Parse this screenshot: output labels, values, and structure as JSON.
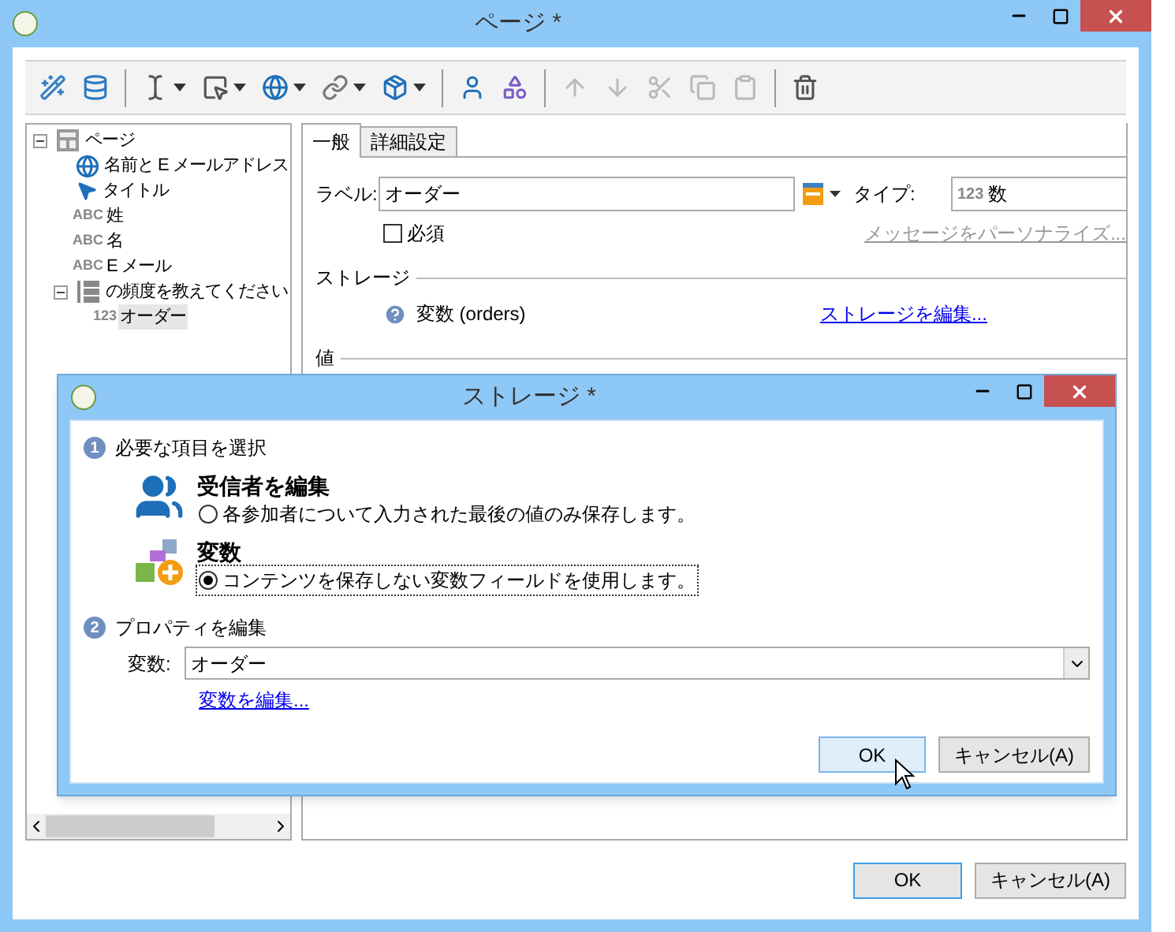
{
  "window": {
    "title": "ページ *"
  },
  "toolbar": [
    {
      "kind": "button",
      "dropdown": false,
      "disabled": false
    },
    {
      "kind": "button",
      "dropdown": false,
      "disabled": false
    },
    {
      "kind": "separator"
    },
    {
      "kind": "button",
      "dropdown": true,
      "disabled": false
    },
    {
      "kind": "button",
      "dropdown": true,
      "disabled": false
    },
    {
      "kind": "button",
      "dropdown": true,
      "disabled": false
    },
    {
      "kind": "button",
      "dropdown": true,
      "disabled": false
    },
    {
      "kind": "button",
      "dropdown": true,
      "disabled": false
    },
    {
      "kind": "separator"
    },
    {
      "kind": "button",
      "dropdown": false,
      "disabled": false
    },
    {
      "kind": "button",
      "dropdown": false,
      "disabled": false
    },
    {
      "kind": "separator"
    },
    {
      "kind": "button",
      "dropdown": false,
      "disabled": true
    },
    {
      "kind": "button",
      "dropdown": false,
      "disabled": true
    },
    {
      "kind": "button",
      "dropdown": false,
      "disabled": true
    },
    {
      "kind": "button",
      "dropdown": false,
      "disabled": true
    },
    {
      "kind": "button",
      "dropdown": false,
      "disabled": true
    },
    {
      "kind": "separator"
    },
    {
      "kind": "button",
      "dropdown": false,
      "disabled": false
    }
  ],
  "tree": [
    {
      "kind": "page",
      "label": "ページ",
      "selected": false,
      "expanded": true,
      "children": [
        {
          "kind": "globe",
          "label": "名前と E メールアドレス",
          "selected": false
        },
        {
          "kind": "cursor",
          "label": "タイトル",
          "selected": false
        },
        {
          "kind": "typed",
          "badge": "ABC",
          "label": "姓",
          "selected": false
        },
        {
          "kind": "typed",
          "badge": "ABC",
          "label": "名",
          "selected": false
        },
        {
          "kind": "typed",
          "badge": "ABC",
          "label": "E メール",
          "selected": false
        },
        {
          "kind": "list",
          "label": "の頻度を教えてください",
          "selected": false,
          "expanded": true,
          "children": [
            {
              "kind": "typed",
              "badge": "123",
              "label": "オーダー",
              "selected": true
            }
          ]
        }
      ]
    }
  ],
  "tabs": [
    {
      "label": "一般",
      "selected": true
    },
    {
      "label": "詳細設定",
      "selected": false
    }
  ],
  "form": {
    "label_field": {
      "label": "ラベル:",
      "value": "オーダー"
    },
    "type_field": {
      "label": "タイプ:",
      "badge": "123",
      "value": "数"
    },
    "required": {
      "label": "必須",
      "checked": false
    },
    "personalize_link": {
      "text": "メッセージをパーソナライズ...",
      "disabled": true
    },
    "storage": {
      "title": "ストレージ",
      "value": "変数 (orders)",
      "link": "ストレージを編集..."
    },
    "value_section": {
      "title": "値"
    }
  },
  "buttons": [
    {
      "label": "OK",
      "default": true
    },
    {
      "label": "キャンセル(A)",
      "default": false
    }
  ],
  "dialog": {
    "title": "ストレージ *",
    "step1": {
      "number": "1",
      "title": "必要な項目を選択"
    },
    "options": [
      {
        "kind": "recipients",
        "title": "受信者を編集",
        "description": "各参加者について入力された最後の値のみ保存します。",
        "selected": false
      },
      {
        "kind": "variable",
        "title": "変数",
        "description": "コンテンツを保存しない変数フィールドを使用します。",
        "selected": true
      }
    ],
    "step2": {
      "number": "2",
      "title": "プロパティを編集"
    },
    "variable_field": {
      "label": "変数:",
      "value": "オーダー"
    },
    "link": "変数を編集...",
    "buttons": [
      {
        "label": "OK",
        "hovered": true
      },
      {
        "label": "キャンセル(A)",
        "hovered": false
      }
    ]
  }
}
